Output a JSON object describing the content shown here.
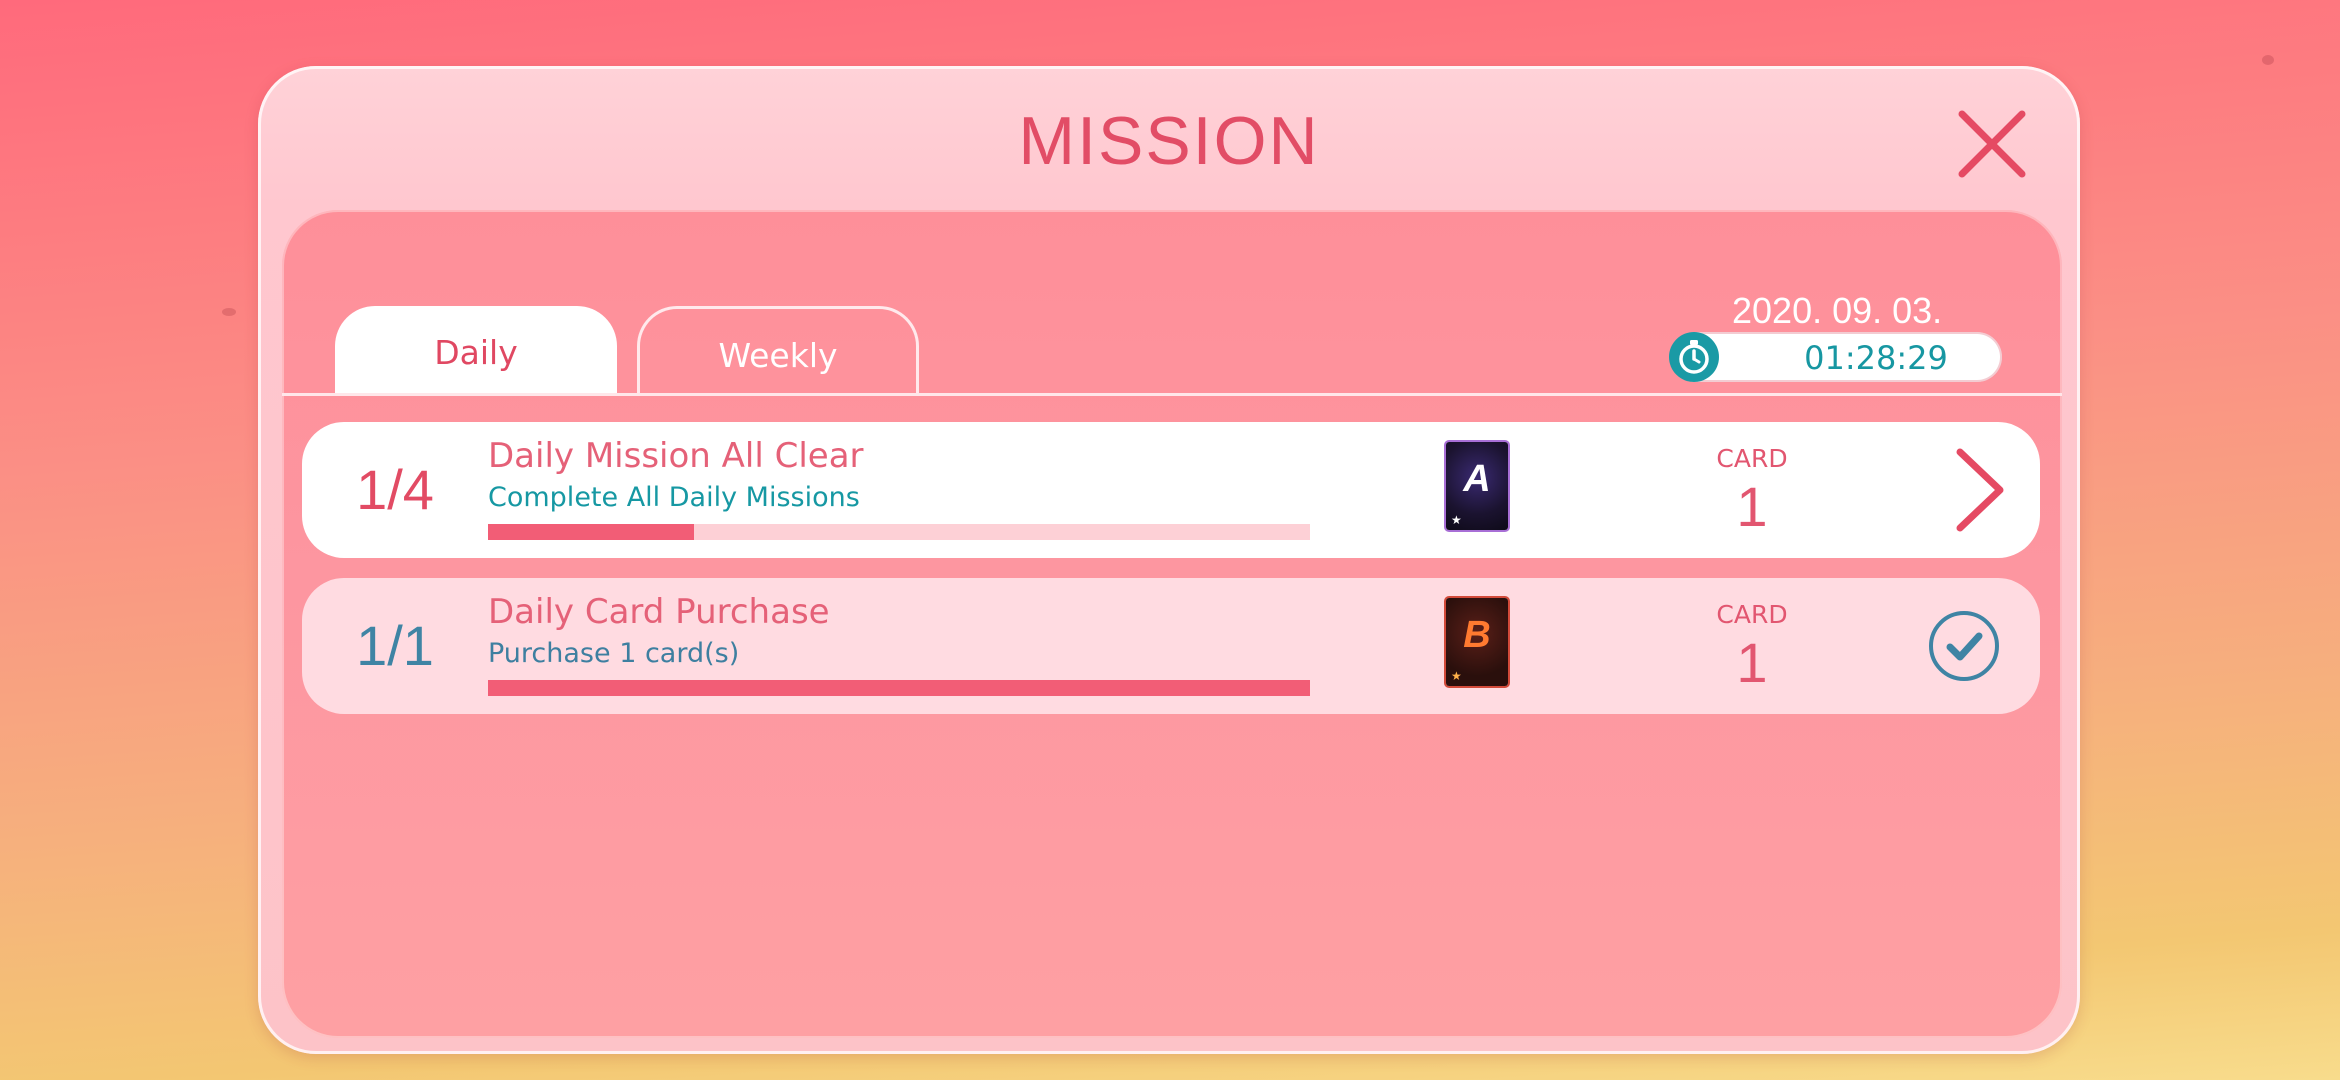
{
  "modal": {
    "title": "MISSION"
  },
  "tabs": [
    {
      "label": "Daily",
      "active": true
    },
    {
      "label": "Weekly",
      "active": false
    }
  ],
  "reset": {
    "date": "2020. 09. 03.",
    "timer": "01:28:29"
  },
  "missions": [
    {
      "progress_text": "1/4",
      "title": "Daily Mission All Clear",
      "description": "Complete All Daily Missions",
      "progress": 0.25,
      "reward_card_letter": "A",
      "reward_label": "CARD",
      "reward_qty": "1",
      "state": "go"
    },
    {
      "progress_text": "1/1",
      "title": "Daily Card Purchase",
      "description": "Purchase 1 card(s)",
      "progress": 1.0,
      "reward_card_letter": "B",
      "reward_label": "CARD",
      "reward_qty": "1",
      "state": "completed"
    }
  ],
  "colors": {
    "accent": "#e24d66",
    "teal": "#1797a2",
    "progress_fill": "#f25d76",
    "completed_blue": "#3f84a4"
  },
  "icons": {
    "close": "close-icon",
    "timer": "stopwatch-icon",
    "go": "chevron-right-icon",
    "done": "check-circle-icon"
  }
}
